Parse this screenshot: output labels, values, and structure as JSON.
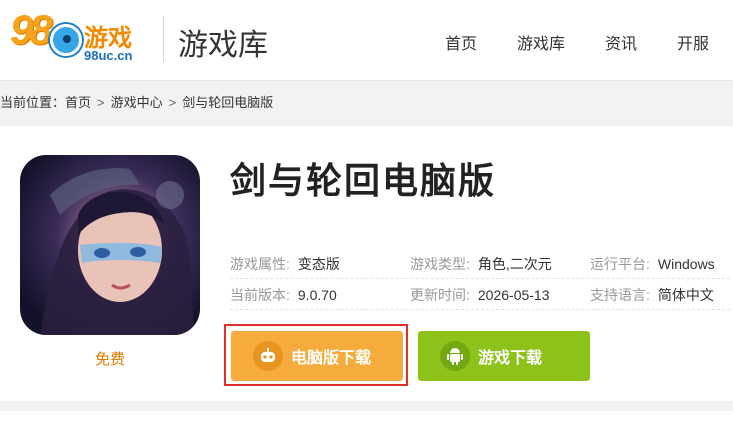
{
  "header": {
    "logo_number": "98",
    "logo_text": "游戏",
    "logo_url": "98uc.cn",
    "site_title": "游戏库",
    "nav": [
      "首页",
      "游戏库",
      "资讯",
      "开服"
    ]
  },
  "breadcrumb": {
    "prefix": "当前位置：",
    "items": [
      "首页",
      "游戏中心",
      "剑与轮回电脑版"
    ],
    "separator": ">"
  },
  "game": {
    "title": "剑与轮回电脑版",
    "price": "免费",
    "attributes": [
      {
        "label": "游戏属性:",
        "value": "变态版"
      },
      {
        "label": "游戏类型:",
        "value": "角色,二次元"
      },
      {
        "label": "运行平台:",
        "value": "Windows"
      },
      {
        "label": "当前版本:",
        "value": "9.0.70"
      },
      {
        "label": "更新时间:",
        "value": "2026-05-13"
      },
      {
        "label": "支持语言:",
        "value": "简体中文"
      }
    ],
    "buttons": {
      "pc_download": "电脑版下载",
      "game_download": "游戏下载"
    }
  },
  "colors": {
    "pc_button": "#f6ac3c",
    "game_button": "#8cc21a",
    "highlight_border": "#e0302e",
    "price": "#e07a00"
  }
}
